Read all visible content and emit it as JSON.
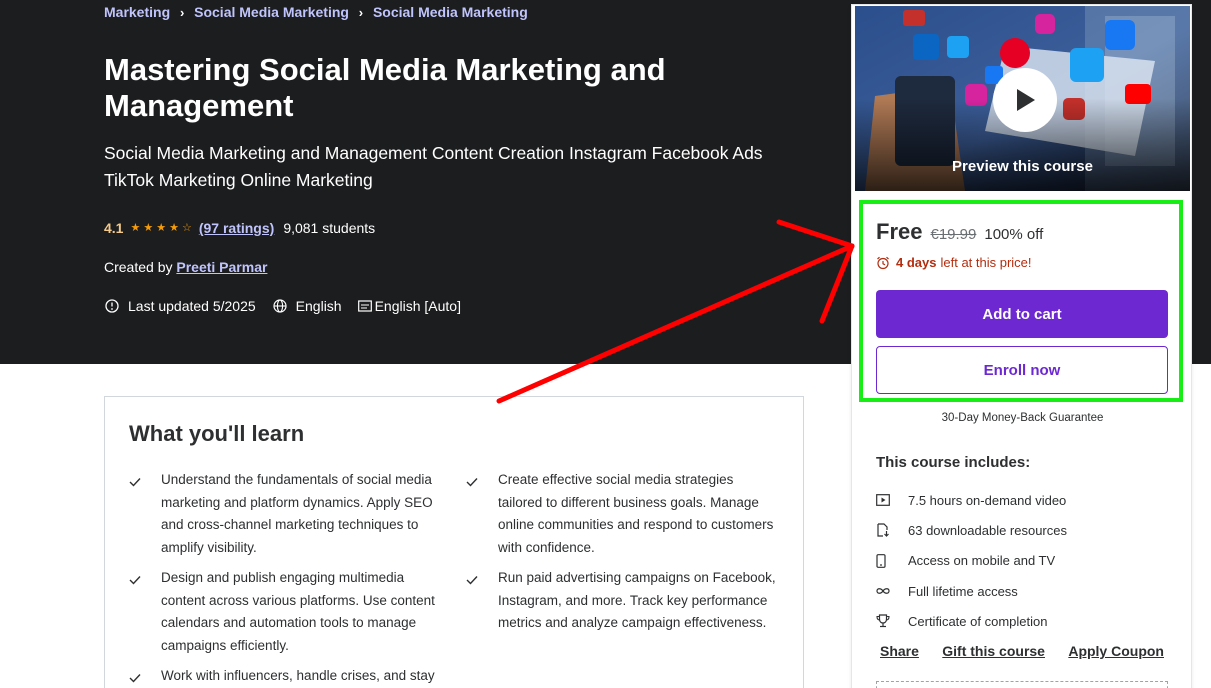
{
  "breadcrumb": {
    "items": [
      "Marketing",
      "Social Media Marketing",
      "Social Media Marketing"
    ]
  },
  "course": {
    "title": "Mastering Social Media Marketing and Management",
    "subtitle": "Social Media Marketing and Management Content Creation Instagram Facebook Ads TikTok Marketing Online Marketing",
    "rating": "4.1",
    "rating_value": 4.1,
    "ratings_count": "(97 ratings)",
    "students": "9,081 students",
    "created_by_label": "Created by",
    "instructor": "Preeti Parmar",
    "last_updated": "Last updated 5/2025",
    "language": "English",
    "captions": "English [Auto]"
  },
  "learn": {
    "heading": "What you'll learn",
    "items": [
      "Understand the fundamentals of social media marketing and platform dynamics. Apply SEO and cross-channel marketing techniques to amplify visibility.",
      "Create effective social media strategies tailored to different business goals. Manage online communities and respond to customers with confidence.",
      "Design and publish engaging multimedia content across various platforms. Use content calendars and automation tools to manage campaigns efficiently.",
      "Run paid advertising campaigns on Facebook, Instagram, and more. Track key performance metrics and analyze campaign effectiveness.",
      "Work with influencers, handle crises, and stay",
      ""
    ]
  },
  "sidebar": {
    "preview_label": "Preview this course",
    "price": "Free",
    "original_price": "€19.99",
    "discount": "100% off",
    "timer_bold": "4 days",
    "timer_rest": "left at this price!",
    "add_to_cart": "Add to cart",
    "enroll_now": "Enroll now",
    "guarantee": "30-Day Money-Back Guarantee",
    "includes_title": "This course includes:",
    "includes": [
      {
        "icon": "video-icon",
        "text": "7.5 hours on-demand video"
      },
      {
        "icon": "download-file-icon",
        "text": "63 downloadable resources"
      },
      {
        "icon": "mobile-icon",
        "text": "Access on mobile and TV"
      },
      {
        "icon": "infinity-icon",
        "text": "Full lifetime access"
      },
      {
        "icon": "trophy-icon",
        "text": "Certificate of completion"
      }
    ],
    "share": "Share",
    "gift": "Gift this course",
    "coupon": "Apply Coupon"
  },
  "colors": {
    "hero_bg": "#1c1d1f",
    "accent_purple": "#6d28d2",
    "link_lavender": "#c0c4fc",
    "rating_gold": "#f69c08",
    "timer_red": "#b32d0f",
    "annotation_green": "#16ee16",
    "annotation_red": "#ff0000"
  }
}
